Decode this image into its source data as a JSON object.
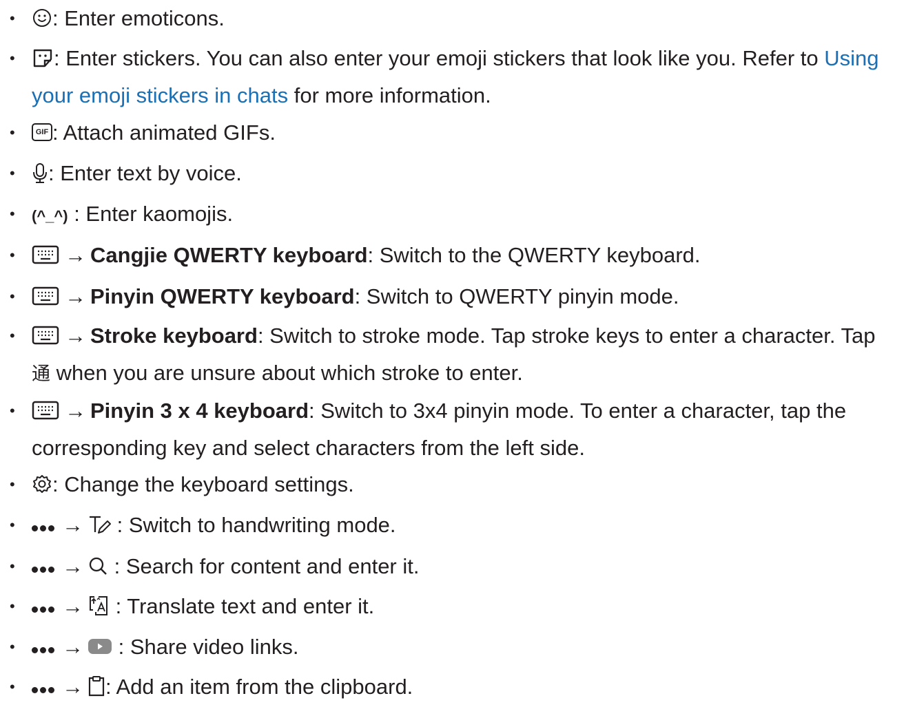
{
  "arrow": "→",
  "items": [
    {
      "icon": "smiley-icon",
      "text": ": Enter emoticons."
    },
    {
      "icon": "sticker-icon",
      "text": ": Enter stickers. You can also enter your emoji stickers that look like you. Refer to ",
      "link1": "Using",
      "link2": "your emoji stickers in chats",
      "after": " for more information."
    },
    {
      "icon": "gif-icon",
      "gif_label": "GIF",
      "text": ": Attach animated GIFs."
    },
    {
      "icon": "microphone-icon",
      "text": ": Enter text by voice."
    },
    {
      "icon": "kaomoji-icon",
      "kaomoji": "(^_^)",
      "text": " : Enter kaomojis."
    },
    {
      "icon": "keyboard-icon",
      "bold": "Cangjie QWERTY keyboard",
      "text": ": Switch to the QWERTY keyboard."
    },
    {
      "icon": "keyboard-icon",
      "bold": "Pinyin QWERTY keyboard",
      "text": ": Switch to QWERTY pinyin mode."
    },
    {
      "icon": "keyboard-icon",
      "bold": "Stroke keyboard",
      "text": ": Switch to stroke mode. Tap stroke keys to enter a character. Tap",
      "han": "通",
      "text2": " when you are unsure about which stroke to enter."
    },
    {
      "icon": "keyboard-icon",
      "bold": "Pinyin 3 x 4 keyboard",
      "text": ": Switch to 3x4 pinyin mode. To enter a character, tap the",
      "text2": "corresponding key and select characters from the left side."
    },
    {
      "icon": "gear-icon",
      "text": ": Change the keyboard settings."
    },
    {
      "icon": "handwriting-icon",
      "text": " : Switch to handwriting mode."
    },
    {
      "icon": "search-icon",
      "text": " : Search for content and enter it."
    },
    {
      "icon": "translate-icon",
      "text": " : Translate text and enter it."
    },
    {
      "icon": "youtube-icon",
      "text": " : Share video links."
    },
    {
      "icon": "clipboard-icon",
      "text": ": Add an item from the clipboard."
    }
  ]
}
